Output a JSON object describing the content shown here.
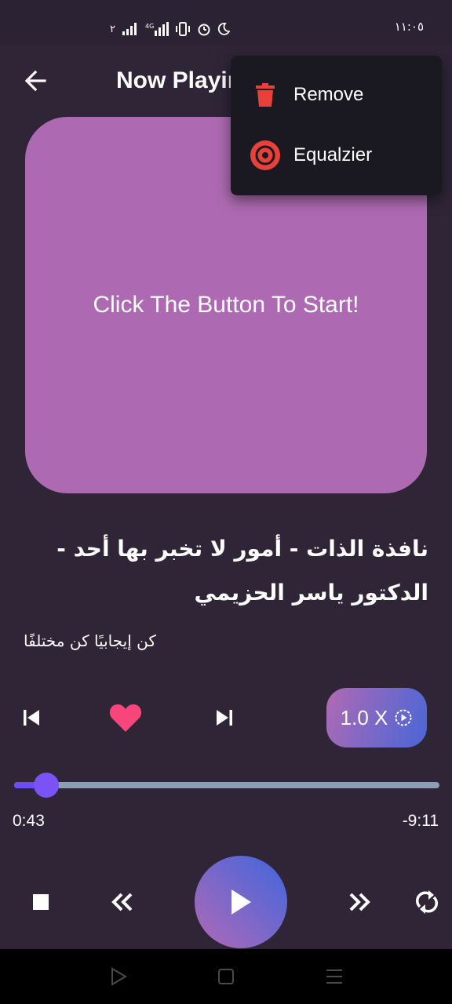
{
  "status_bar": {
    "time": "١١:٠٥",
    "left_text": "٢"
  },
  "header": {
    "title": "Now Playing",
    "back_icon": "arrow-left-icon"
  },
  "artwork": {
    "text": "Click The Button To Start!",
    "color": "#ad6ab2"
  },
  "track": {
    "title": "نافذة الذات - أمور لا تخبر بها أحد - الدكتور ياسر الحزيمي",
    "subtitle": "كن إيجابيًا كن مختلفًا"
  },
  "controls": {
    "speed_label": "1.0 X",
    "favorite_color": "#f8467c",
    "elapsed": "0:43",
    "remaining": "-9:11",
    "progress_fraction": 0.076
  },
  "menu": {
    "items": [
      {
        "label": "Remove",
        "icon": "trash-icon"
      },
      {
        "label": "Equalzier",
        "icon": "disc-icon"
      }
    ],
    "icon_color": "#e9413a"
  },
  "colors": {
    "background": "#2f2537",
    "accent": "#6a4ef5"
  }
}
